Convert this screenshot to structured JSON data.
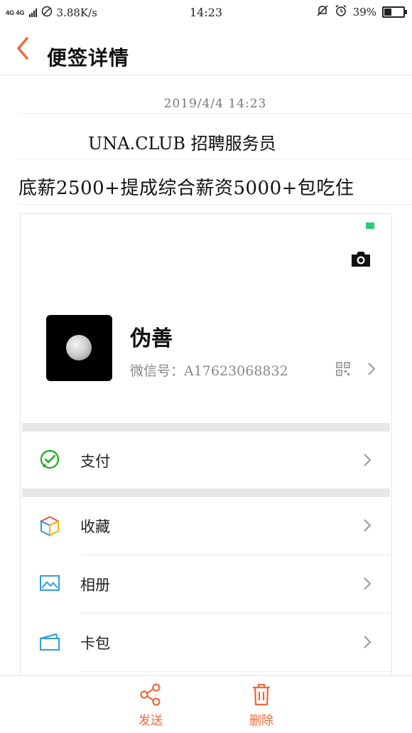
{
  "status_bar": {
    "network": "4G 4G",
    "speed": "3.88K/s",
    "time": "14:23",
    "battery_text": "39%",
    "battery_level": 0.39
  },
  "header": {
    "title": "便签详情",
    "accent_color": "#ee6a3a"
  },
  "note": {
    "date": "2019/4/4 14:23",
    "line1": "UNA.CLUB 招聘服务员",
    "line2": "底薪2500+提成综合薪资5000+包吃住"
  },
  "embedded_screenshot": {
    "nickname": "伪善",
    "wechat_id": "微信号：A17623068832",
    "menu_items": [
      {
        "label": "支付",
        "icon": "wechat-pay-icon"
      },
      {
        "label": "收藏",
        "icon": "favorites-cube-icon"
      },
      {
        "label": "相册",
        "icon": "album-icon"
      },
      {
        "label": "卡包",
        "icon": "card-wallet-icon"
      }
    ]
  },
  "toolbar": {
    "send_label": "发送",
    "delete_label": "删除",
    "send_icon": "share-icon",
    "delete_icon": "trash-icon"
  }
}
